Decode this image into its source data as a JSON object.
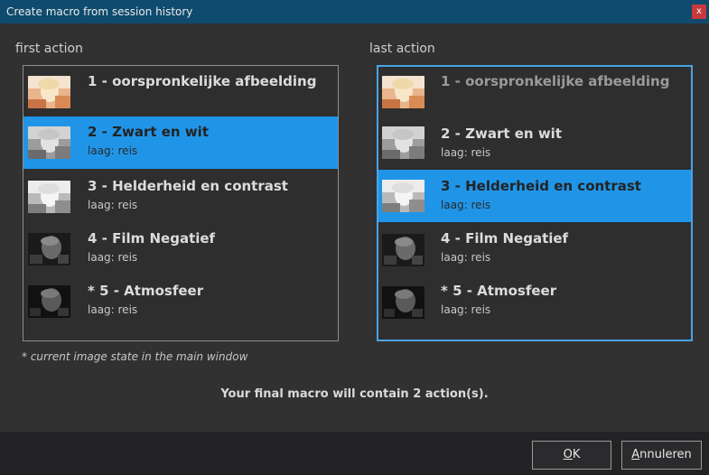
{
  "window": {
    "title": "Create macro from session history",
    "close_label": "x"
  },
  "first_panel": {
    "label": "first action",
    "items": [
      {
        "title": "1 - oorspronkelijke afbeelding",
        "sub": ""
      },
      {
        "title": "2 - Zwart en wit",
        "sub": "laag: reis"
      },
      {
        "title": "3 - Helderheid en contrast",
        "sub": "laag: reis"
      },
      {
        "title": "4 - Film Negatief",
        "sub": "laag: reis"
      },
      {
        "title": "* 5 - Atmosfeer",
        "sub": "laag: reis"
      }
    ],
    "selected_index": 1
  },
  "last_panel": {
    "label": "last action",
    "items": [
      {
        "title": "1 - oorspronkelijke afbeelding",
        "sub": ""
      },
      {
        "title": "2 - Zwart en wit",
        "sub": "laag: reis"
      },
      {
        "title": "3 - Helderheid en contrast",
        "sub": "laag: reis"
      },
      {
        "title": "4 - Film Negatief",
        "sub": "laag: reis"
      },
      {
        "title": "* 5 - Atmosfeer",
        "sub": "laag: reis"
      }
    ],
    "selected_index": 2
  },
  "footnote": "* current image state in the main window",
  "summary": "Your final macro will contain 2 action(s).",
  "buttons": {
    "ok_mnemonic": "O",
    "ok_rest": "K",
    "cancel_mnemonic": "A",
    "cancel_rest": "nnuleren"
  },
  "colors": {
    "selection": "#2095e8",
    "focus_border": "#4aa3e6",
    "titlebar": "#0f4b6e",
    "close": "#c8393d"
  },
  "icons": {
    "thumb_original": "photo-color-thumbnail",
    "thumb_bw": "photo-grayscale-thumbnail",
    "thumb_bright": "photo-bright-grayscale-thumbnail",
    "thumb_negative": "photo-negative-thumbnail",
    "thumb_atmos": "photo-atmosphere-thumbnail"
  }
}
